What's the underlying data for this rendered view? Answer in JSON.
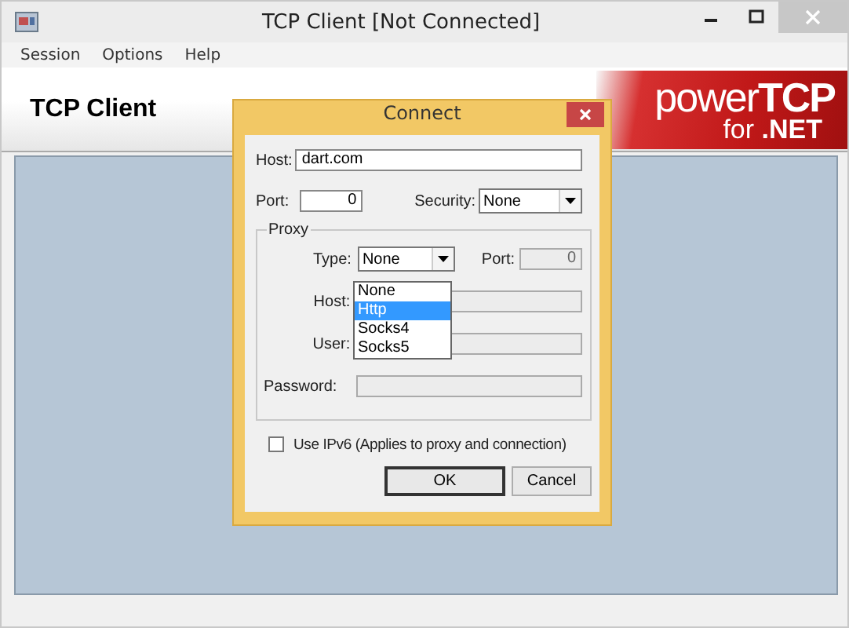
{
  "window": {
    "title": "TCP Client  [Not Connected]"
  },
  "menu": [
    {
      "label": "Session"
    },
    {
      "label": "Options"
    },
    {
      "label": "Help"
    }
  ],
  "header": {
    "title": "TCP Client",
    "logo": {
      "brand_light": "power",
      "brand_bold": "TCP",
      "sub_light": "for",
      "sub_bold": ".NET"
    }
  },
  "dialog": {
    "title": "Connect",
    "host": {
      "label": "Host:",
      "value": "dart.com"
    },
    "port": {
      "label": "Port:",
      "value": "0"
    },
    "security": {
      "label": "Security:",
      "value": "None"
    },
    "proxy": {
      "legend": "Proxy",
      "type": {
        "label": "Type:",
        "value": "None",
        "expanded": true,
        "options": [
          {
            "label": "None",
            "highlighted": false
          },
          {
            "label": "Http",
            "highlighted": true
          },
          {
            "label": "Socks4",
            "highlighted": false
          },
          {
            "label": "Socks5",
            "highlighted": false
          }
        ]
      },
      "port": {
        "label": "Port:",
        "value": "0",
        "disabled": true
      },
      "host": {
        "label": "Host:",
        "disabled": true
      },
      "user": {
        "label": "User:",
        "disabled": true
      },
      "password": {
        "label": "Password:",
        "disabled": true
      }
    },
    "ipv6": {
      "label": "Use IPv6 (Applies to proxy and connection)",
      "checked": false
    },
    "buttons": [
      {
        "label": "OK",
        "default": true
      },
      {
        "label": "Cancel",
        "default": false
      }
    ]
  }
}
